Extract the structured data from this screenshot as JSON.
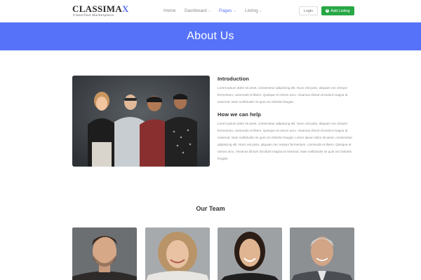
{
  "brand": {
    "name_main": "CLASSIMA",
    "name_accent": "X",
    "tagline": "Classified Marketplace"
  },
  "nav": {
    "items": [
      {
        "label": "Home",
        "dropdown": false,
        "active": false
      },
      {
        "label": "Dashboard",
        "dropdown": true,
        "active": false
      },
      {
        "label": "Pages",
        "dropdown": true,
        "active": true
      },
      {
        "label": "Listing",
        "dropdown": true,
        "active": false
      }
    ],
    "login_label": "Login",
    "add_listing_label": "Add Listing"
  },
  "banner": {
    "title": "About Us"
  },
  "about": {
    "intro_heading": "Introduction",
    "intro_text": "Lorem ipsum dolor sit amet, consectetur adipiscing elit. Nunc est justo, aliquam nec tempor fermentum, commodo et libero. Quisque et rutrum arcu. Vivamus dictum tincidunt magna id euismod. Nam sollicitudin mi quis orci lobortis feugiat.",
    "help_heading": "How we can help",
    "help_text": "Lorem ipsum dolor sit amet, consectetur adipiscing elit. Nunc est justo, aliquam nec tempor fermentum, commodo et libero. Quisque et rutrum arcu. Vivamus dictum tincidunt magna id euismod. Nam sollicitudin mi quis orci lobortis feugiat. Lorem ipsum dolor sit amet, consectetur adipiscing elit. Nunc est justo, aliquam nec tempor fermentum, commodo et libero. Quisque et rutrum arcu. Vivamus dictum tincidunt magna id euismod. Nam sollicitudin mi quis orci lobortis feugiat."
  },
  "team": {
    "title": "Our Team"
  },
  "colors": {
    "accent": "#5672f9",
    "button_green": "#28a745"
  }
}
